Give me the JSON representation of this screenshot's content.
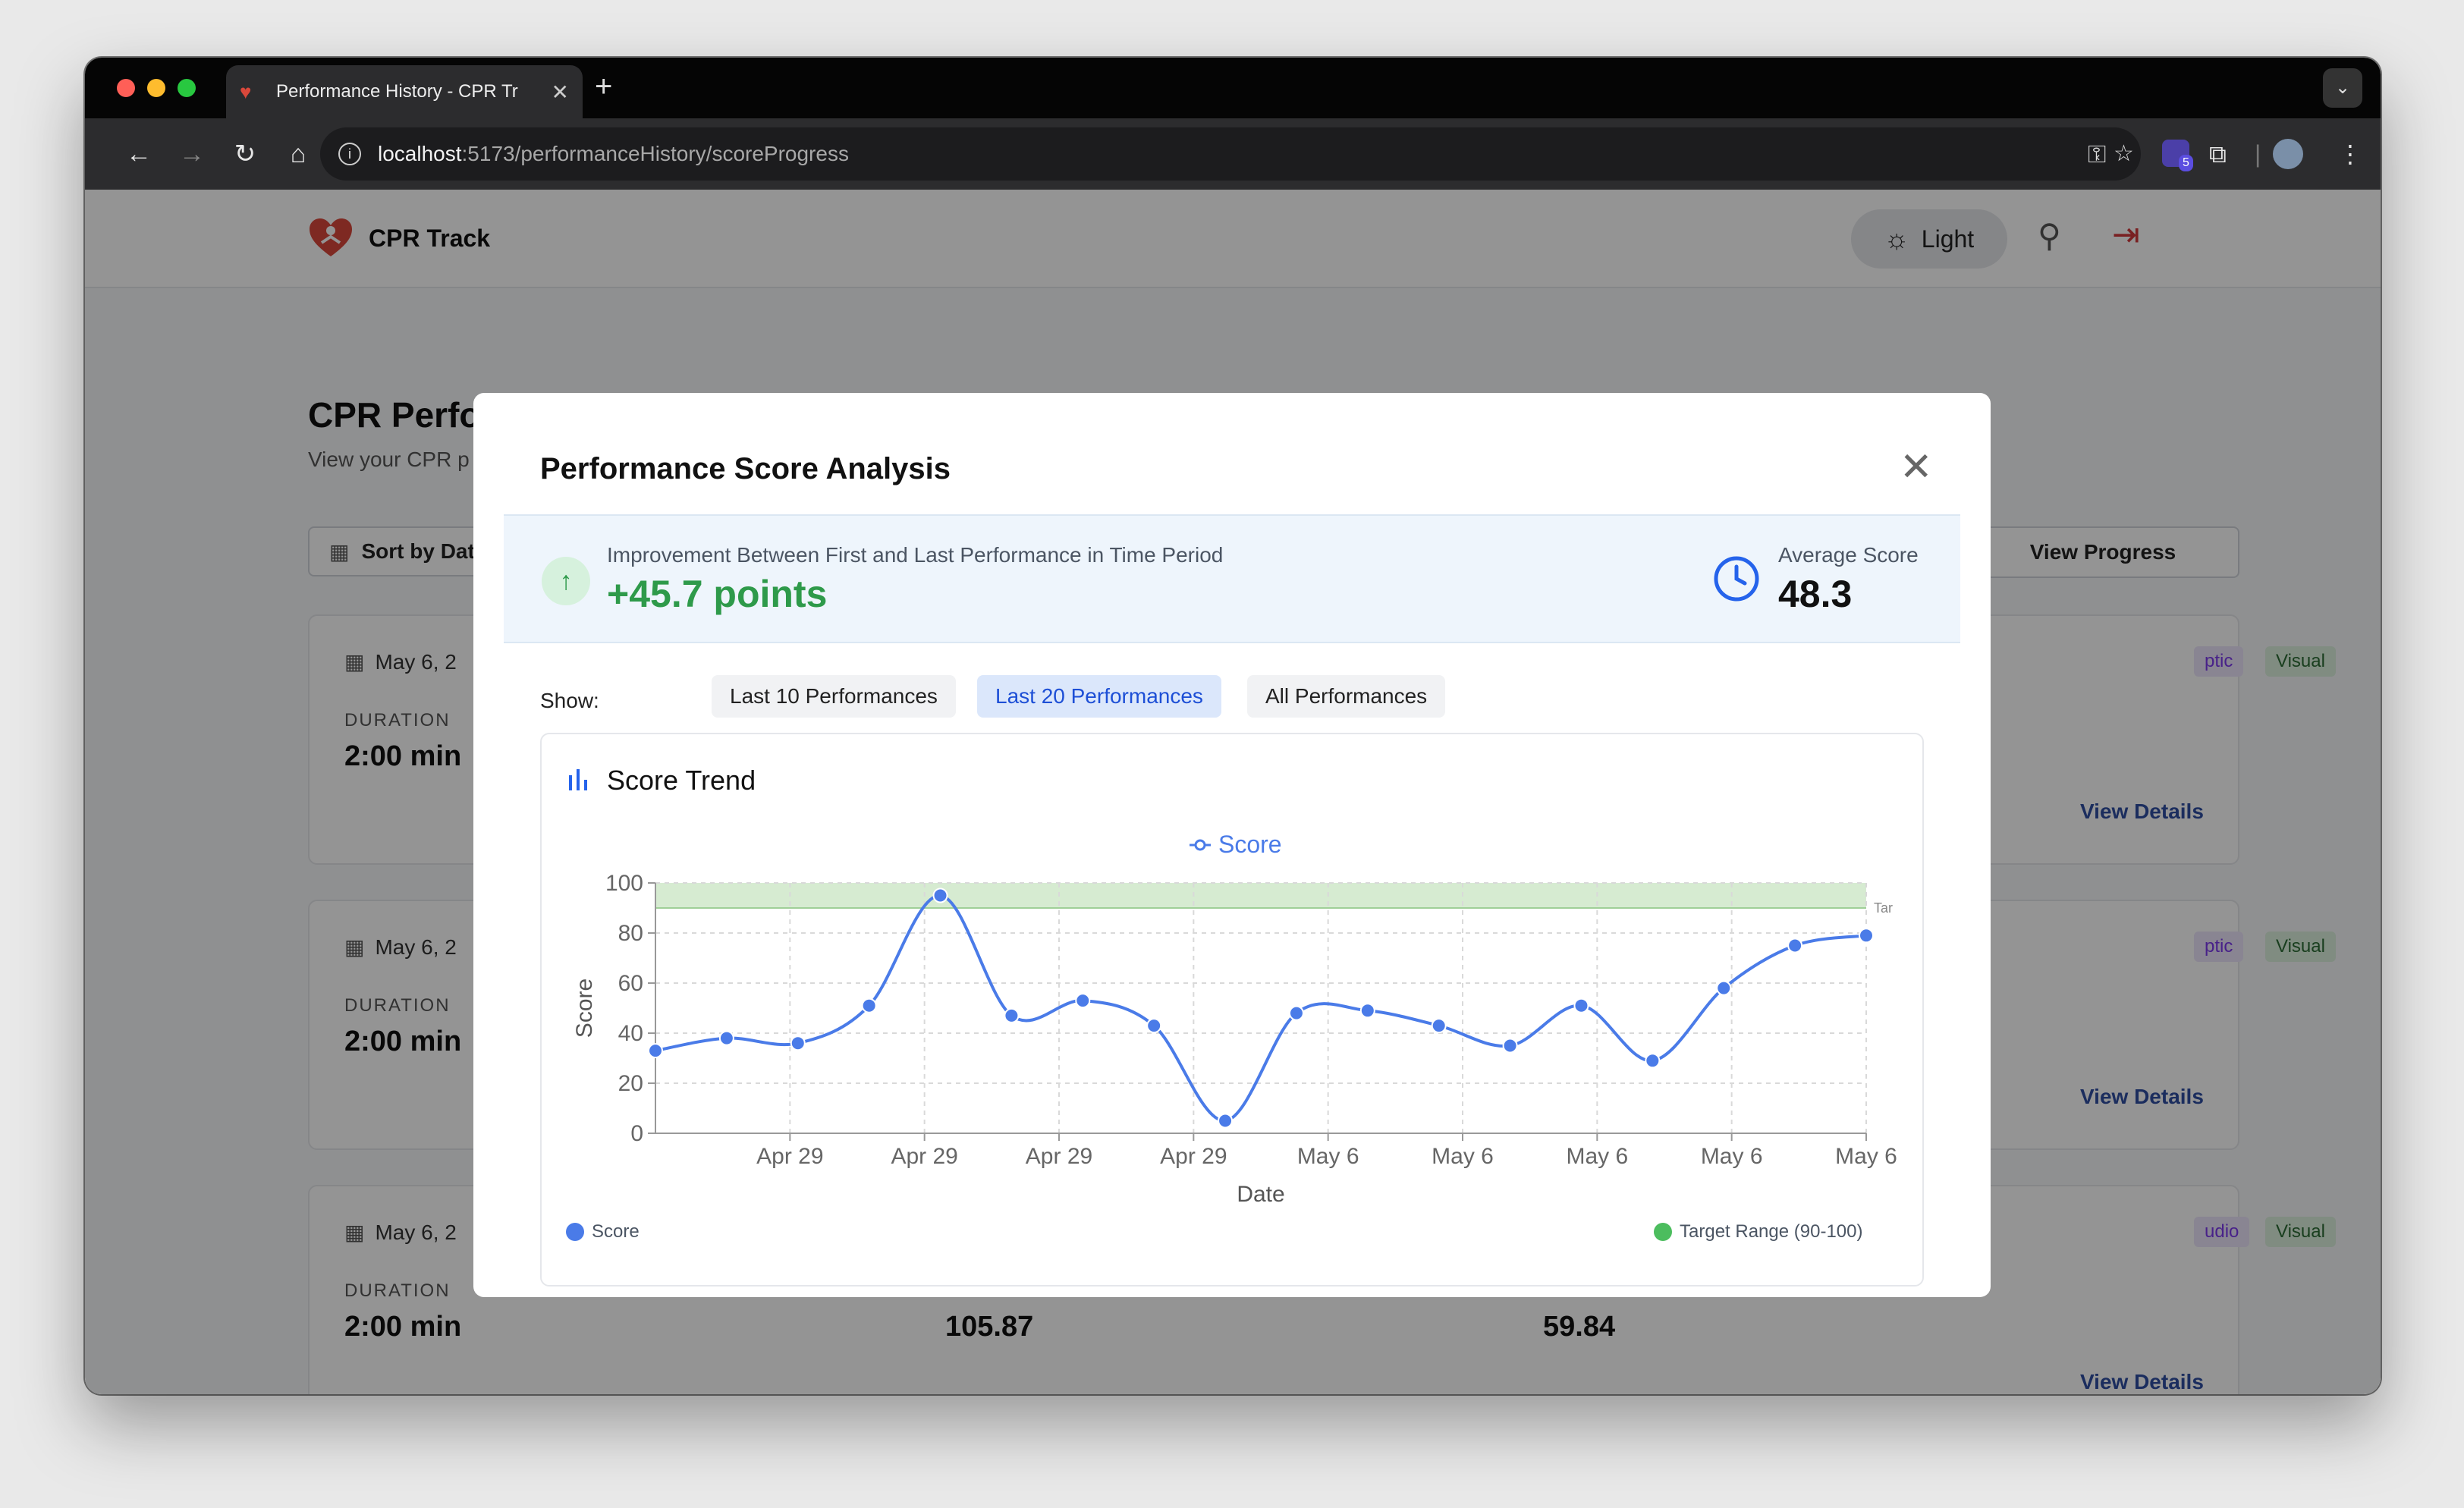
{
  "browser": {
    "tab_title": "Performance History - CPR Tr",
    "url_host": "localhost",
    "url_path": ":5173/performanceHistory/scoreProgress",
    "extension_badge": "5"
  },
  "header": {
    "brand": "CPR Track",
    "theme_label": "Light"
  },
  "page": {
    "title": "CPR Perfo",
    "subtitle": "View your CPR p",
    "sort_label": "Sort by Dat",
    "view_progress_label": "View Progress",
    "cards": [
      {
        "date": "May 6, 2",
        "duration_label": "DURATION",
        "duration": "2:00 min",
        "value2": "",
        "value3": "",
        "tag1": "ptic",
        "tag2": "Visual",
        "details": "View Details"
      },
      {
        "date": "May 6, 2",
        "duration_label": "DURATION",
        "duration": "2:00 min",
        "value2": "",
        "value3": "",
        "tag1": "ptic",
        "tag2": "Visual",
        "details": "View Details"
      },
      {
        "date": "May 6, 2",
        "duration_label": "DURATION",
        "duration": "2:00 min",
        "value2": "105.87",
        "value3": "59.84",
        "tag1": "udio",
        "tag2": "Visual",
        "details": "View Details"
      }
    ]
  },
  "modal": {
    "title": "Performance Score Analysis",
    "improvement_label": "Improvement Between First and Last Performance in Time Period",
    "improvement_value": "+45.7 points",
    "average_label": "Average Score",
    "average_value": "48.3",
    "show_label": "Show:",
    "filters": [
      "Last 10 Performances",
      "Last 20 Performances",
      "All Performances"
    ],
    "active_filter": 1,
    "chart_title": "Score Trend",
    "legend_score": "Score",
    "legend_target": "Target Range (90-100)"
  },
  "chart_data": {
    "type": "line",
    "title": "Score Trend",
    "series": [
      {
        "name": "Score",
        "color": "#4a7be8",
        "values": [
          33,
          38,
          36,
          51,
          95,
          47,
          53,
          43,
          5,
          48,
          49,
          43,
          35,
          51,
          29,
          58,
          75,
          79
        ]
      }
    ],
    "x_tick_labels": [
      "Apr 29",
      "Apr 29",
      "Apr 29",
      "Apr 29",
      "May 6",
      "May 6",
      "May 6",
      "May 6",
      "May 6"
    ],
    "xlabel": "Date",
    "ylabel": "Score",
    "ylim": [
      0,
      100
    ],
    "yticks": [
      0,
      20,
      40,
      60,
      80,
      100
    ],
    "target_range": [
      90,
      100
    ],
    "target_label": "Tar",
    "target_color": "#cfe8c9",
    "grid": true
  },
  "colors": {
    "accent": "#2563eb",
    "positive": "#2e9a4a",
    "danger": "#d0383b"
  }
}
